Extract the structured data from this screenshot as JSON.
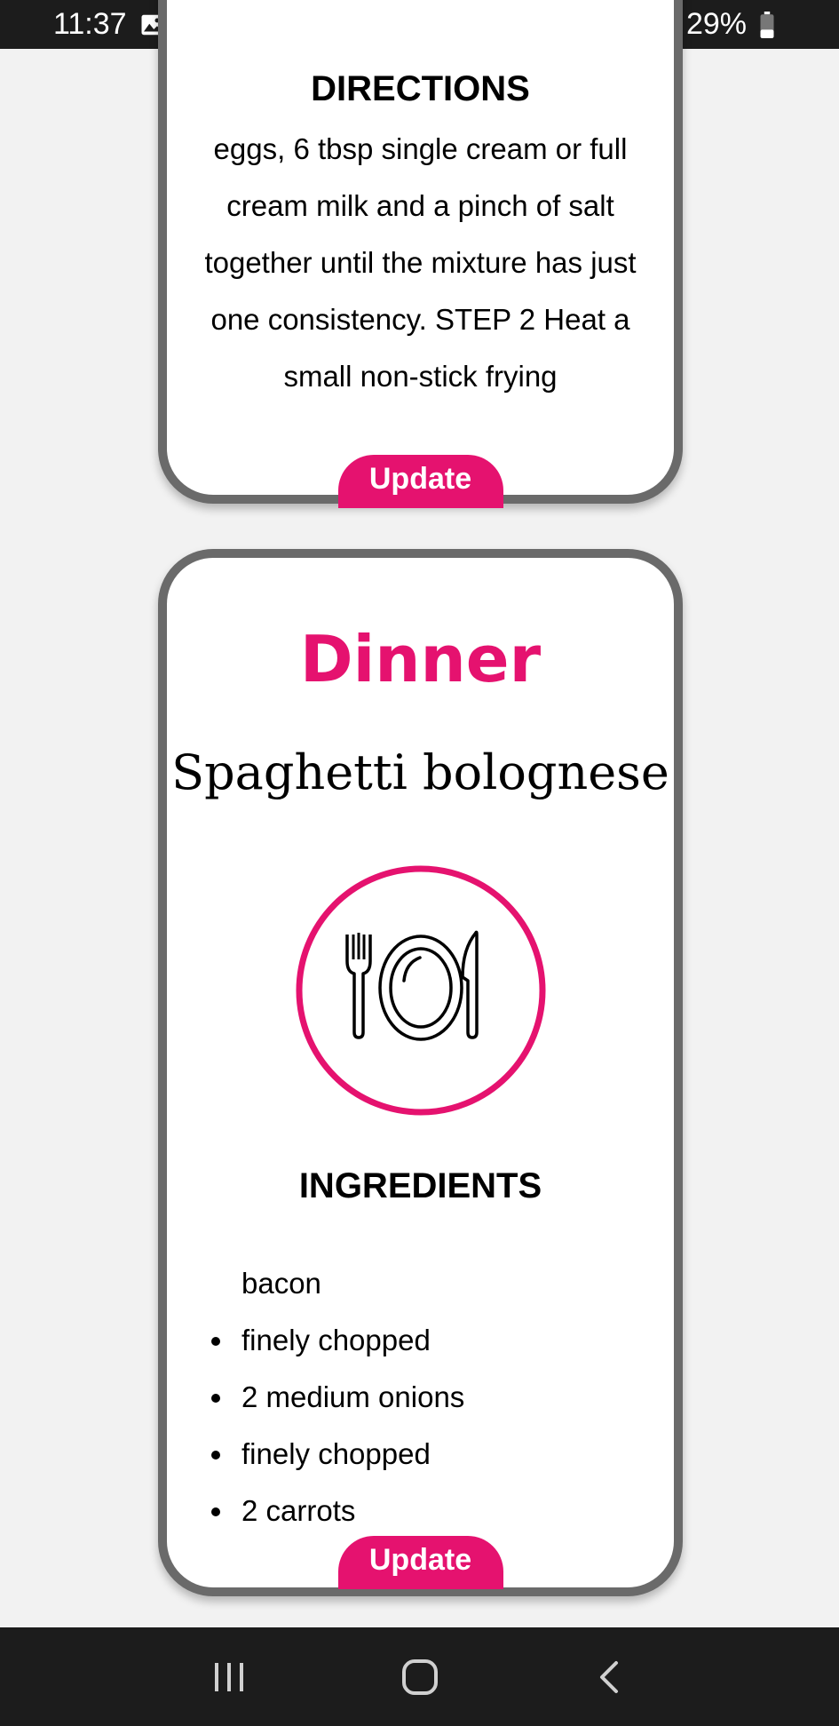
{
  "status_bar": {
    "time": "11:37",
    "battery": "29%",
    "icons_left": [
      "image-icon",
      "accessibility-icon",
      "media-icon"
    ],
    "icons_right": [
      "wifi-icon",
      "volte-icon",
      "signal-icon",
      "battery-icon"
    ]
  },
  "card_top": {
    "section_title": "DIRECTIONS",
    "directions": "eggs, 6 tbsp single cream or full cream milk and a pinch of salt together until the mixture has just one consistency. STEP 2 Heat a small non-stick frying",
    "update_label": "Update"
  },
  "card_bottom": {
    "meal": "Dinner",
    "recipe_name": "Spaghetti bolognese",
    "icon": "plate-cutlery-icon",
    "section_title": "INGREDIENTS",
    "ingredients": [
      {
        "text": "bacon",
        "bullet": false
      },
      {
        "text": "finely chopped",
        "bullet": true
      },
      {
        "text": "2 medium onions",
        "bullet": true
      },
      {
        "text": "finely chopped",
        "bullet": true
      },
      {
        "text": "2 carrots",
        "bullet": true
      }
    ],
    "update_label": "Update"
  },
  "colors": {
    "accent": "#e5126f",
    "card_border": "#6a6a6a",
    "bars": "#1c1c1c",
    "background": "#f2f2f2"
  },
  "nav_bar": {
    "buttons": [
      "recent-apps-icon",
      "home-icon",
      "back-icon"
    ]
  }
}
